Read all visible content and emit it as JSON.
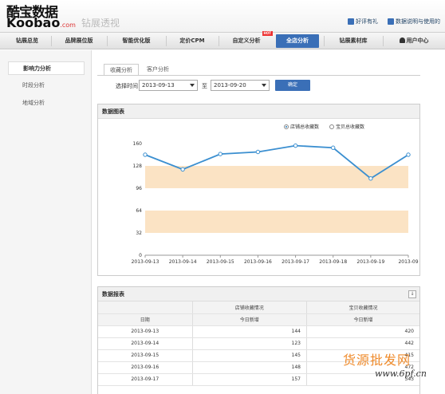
{
  "header": {
    "logo_cn": "酷宝数据",
    "logo_en": "Koobao",
    "logo_dotcom": ".com",
    "product": "钻展透视",
    "links": [
      "好评有礼",
      "数据说明与使用的"
    ]
  },
  "nav": {
    "items": [
      "钻展总览",
      "品牌展位版",
      "智能优化版",
      "定价CPM",
      "自定义分析",
      "全店分析",
      "钻展素材库",
      "用户中心"
    ],
    "hot_badge": "HOT",
    "active": "全店分析"
  },
  "sidebar": {
    "items": [
      "影响力分析",
      "时段分析",
      "地域分析"
    ]
  },
  "tabs": [
    "收藏分析",
    "客户分析"
  ],
  "filter": {
    "label": "选择时间",
    "start": "2013-09-13",
    "sep": "至",
    "end": "2013-09-20",
    "confirm": "确定"
  },
  "chart_panel": {
    "title": "数据图表",
    "legend": [
      "店铺总收藏数",
      "宝贝总收藏数"
    ]
  },
  "chart_data": {
    "type": "line",
    "categories": [
      "2013-09-13",
      "2013-09-14",
      "2013-09-15",
      "2013-09-16",
      "2013-09-17",
      "2013-09-18",
      "2013-09-19",
      "2013-09"
    ],
    "series": [
      {
        "name": "店铺总收藏数",
        "values": [
          144,
          123,
          145,
          148,
          157,
          154,
          110,
          144
        ]
      }
    ],
    "ylim": [
      0,
      160
    ],
    "yticks": [
      "0",
      "32",
      "64",
      "96",
      "128",
      "160"
    ],
    "bands": [
      [
        96,
        128
      ],
      [
        32,
        64
      ]
    ],
    "colors": {
      "line": "#3b8fd0",
      "band": "#fbe3c4"
    }
  },
  "table_panel": {
    "title": "数据报表",
    "export_icon": "export-icon",
    "group_headers": [
      "店铺收藏情况",
      "宝贝收藏情况"
    ],
    "col_headers": [
      "日期",
      "今日新增",
      "今日新增"
    ],
    "rows": [
      [
        "2013-09-13",
        "144",
        "420"
      ],
      [
        "2013-09-14",
        "123",
        "442"
      ],
      [
        "2013-09-15",
        "145",
        "415"
      ],
      [
        "2013-09-16",
        "148",
        "472"
      ],
      [
        "2013-09-17",
        "157",
        "343"
      ]
    ]
  },
  "watermark": {
    "text": "货源批发网",
    "url": "www.6pf.cn"
  }
}
